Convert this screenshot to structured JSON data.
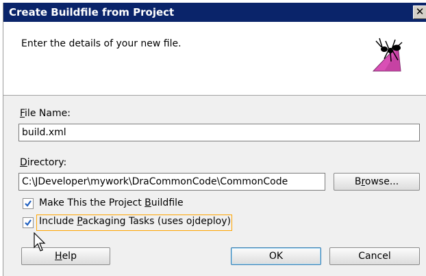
{
  "dialog": {
    "title": "Create Buildfile from Project",
    "close_label": "✕",
    "header_text": "Enter the details of your new file."
  },
  "file_name": {
    "label_mnemonic": "F",
    "label_rest": "ile Name:",
    "value": "build.xml"
  },
  "directory": {
    "label_mnemonic": "D",
    "label_rest": "irectory:",
    "value": "C:\\JDeveloper\\mywork\\DraCommonCode\\CommonCode",
    "browse_pre": "B",
    "browse_mnemonic": "r",
    "browse_post": "owse..."
  },
  "options": {
    "make_project_pre": "Make This the Project ",
    "make_project_mnemonic": "B",
    "make_project_post": "uildfile",
    "make_project_checked": true,
    "include_pre": "Include ",
    "include_mnemonic": "P",
    "include_post": "ackaging Tasks (uses ojdeploy)",
    "include_checked": true
  },
  "buttons": {
    "help_mnemonic": "H",
    "help_rest": "elp",
    "ok": "OK",
    "cancel": "Cancel"
  },
  "icons": {
    "logo": "ant-icon",
    "checkbox": "checkmark-icon",
    "cursor": "mouse-pointer-icon"
  },
  "colors": {
    "title_bar": "#0a246a",
    "checkmark": "#1f5fbf",
    "focus": "#ffa500",
    "pink": "#d94fb5"
  }
}
